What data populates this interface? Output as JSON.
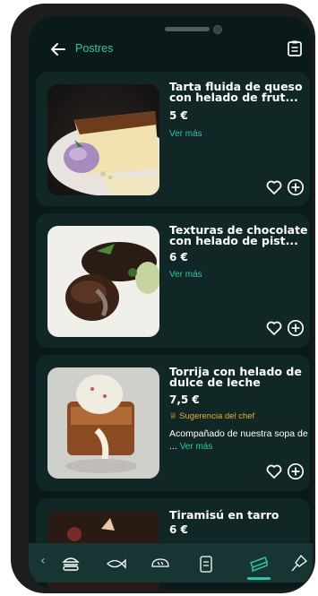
{
  "header": {
    "title": "Postres",
    "back_icon": "arrow-left-icon",
    "menu_icon": "clipboard-list-icon"
  },
  "colors": {
    "accent": "#2fc4a8",
    "background": "#0a1a19",
    "card": "#102725",
    "suggestion": "#e6b32b"
  },
  "dishes": [
    {
      "name": "Tarta fluida de queso con helado de frut...",
      "price": "5 €",
      "more": "Ver más"
    },
    {
      "name": "Texturas de chocolate con helado de pist...",
      "price": "6 €",
      "more": "Ver más"
    },
    {
      "name": "Torrija con helado de dulce de leche",
      "price": "7,5 €",
      "suggestion": "Sugerencia del chef",
      "description": "Acompañado de nuestra sopa de ...",
      "more": "Ver más"
    },
    {
      "name": "Tiramisú en tarro",
      "price": "6 €"
    }
  ],
  "bottom_nav": {
    "items": [
      "burger-icon",
      "fish-icon",
      "bread-icon",
      "clipboard-icon",
      "cake-icon",
      "wine-glass-icon"
    ],
    "active": "cake-icon"
  }
}
